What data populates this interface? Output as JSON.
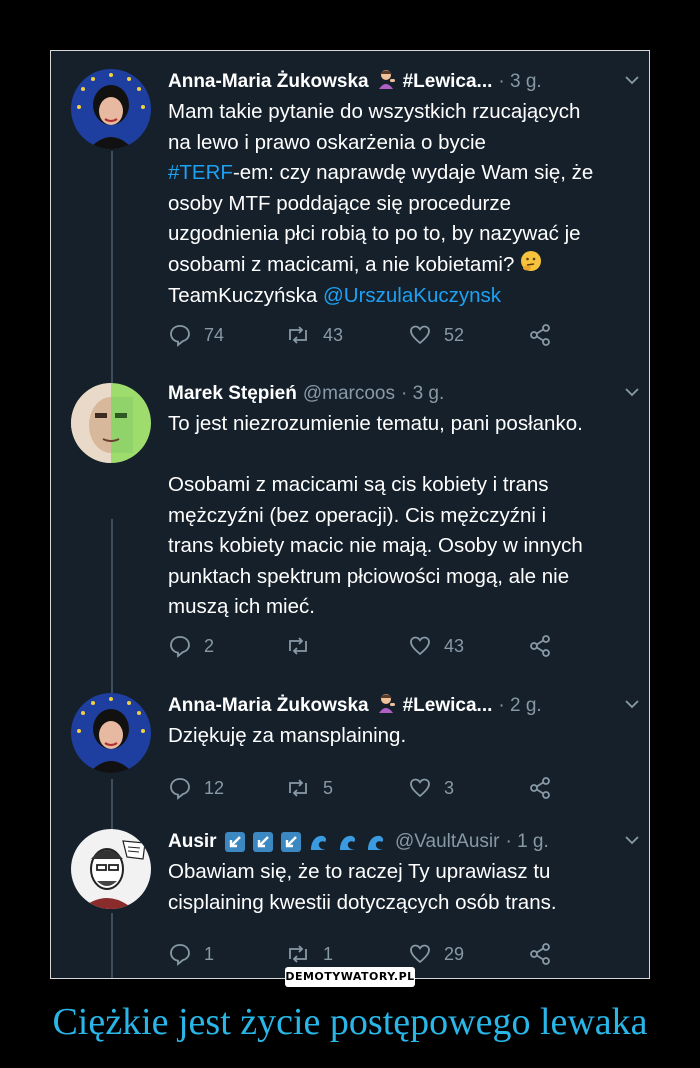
{
  "tweets": [
    {
      "name": "Anna-Maria Żukowska",
      "badge_text": "#Lewica...",
      "handle": "",
      "time": "· 3 g.",
      "lines": [
        "Mam takie pytanie do wszystkich rzucających",
        "na lewo i prawo oskarżenia o bycie",
        "-em: czy naprawdę wydaje Wam się, że",
        "osoby MTF poddające się procedurze",
        "uzgodnienia płci robią to po to, by nazywać je",
        "osobami z macicami, a nie kobietami?",
        "TeamKuczyńska"
      ],
      "hashtag": "#TERF",
      "mention": "@UrszulaKuczynsk",
      "replies": "74",
      "retweets": "43",
      "likes": "52"
    },
    {
      "name": "Marek Stępień",
      "handle": "@marcoos",
      "time": "· 3 g.",
      "lines": [
        "To jest niezrozumienie tematu, pani posłanko.",
        "",
        "Osobami z macicami są cis kobiety i trans",
        "mężczyźni (bez operacji). Cis mężczyźni i",
        "trans kobiety macic nie mają. Osoby w innych",
        "punktach spektrum płciowości mogą, ale nie",
        "muszą ich mieć."
      ],
      "replies": "2",
      "retweets": "",
      "likes": "43"
    },
    {
      "name": "Anna-Maria Żukowska",
      "badge_text": "#Lewica...",
      "time": "· 2 g.",
      "lines": [
        "Dziękuję za mansplaining."
      ],
      "replies": "12",
      "retweets": "5",
      "likes": "3"
    },
    {
      "name": "Ausir",
      "handle": "@VaultAusir",
      "time": "· 1 g.",
      "lines": [
        "Obawiam się, że to raczej Ty uprawiasz tu",
        "cisplaining kwestii dotyczących osób trans."
      ],
      "replies": "1",
      "retweets": "1",
      "likes": "29"
    }
  ],
  "watermark": "DEMOTYWATORY.PL",
  "caption": "Ciężkie jest życie postępowego lewaka",
  "colors": {
    "background": "#15202b",
    "link": "#1da1f2",
    "muted": "#8899a6",
    "caption": "#29b6e8"
  }
}
